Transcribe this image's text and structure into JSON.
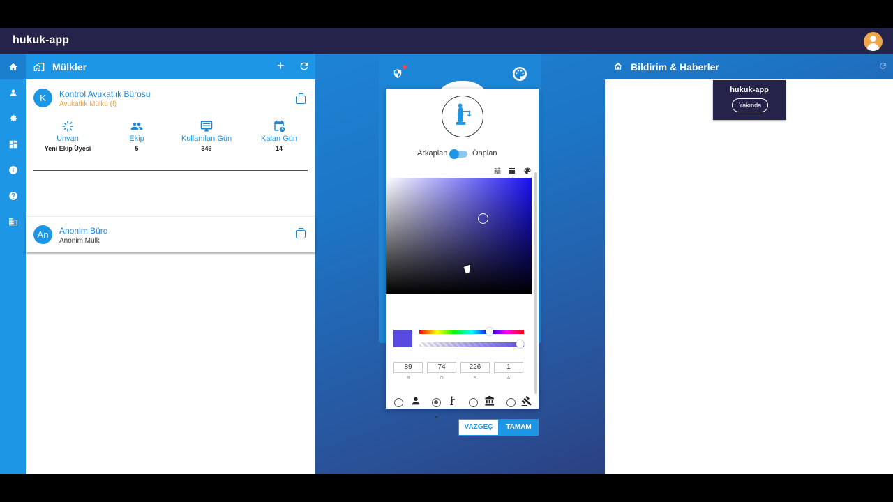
{
  "app": {
    "title": "hukuk-app"
  },
  "rail": {
    "icons": [
      "home-icon",
      "person-icon",
      "gear-icon",
      "dashboard-icon",
      "info-icon",
      "help-icon",
      "building-icon"
    ]
  },
  "left_panel": {
    "title": "Mülkler",
    "add_label": "+",
    "cards": [
      {
        "initial": "K",
        "name": "Kontrol Avukatlık Bürosu",
        "subtitle": "Avukatlık Mülkü (!)",
        "subtitle_color": "#f0a030",
        "stats": [
          {
            "label": "Unvan",
            "value": "Yeni Ekip Üyesi",
            "icon": "spinner-icon"
          },
          {
            "label": "Ekip",
            "value": "5",
            "icon": "people-icon"
          },
          {
            "label": "Kullanılan Gün",
            "value": "349",
            "icon": "monitor-icon"
          },
          {
            "label": "Kalan Gün",
            "value": "14",
            "icon": "calendar-icon"
          }
        ]
      },
      {
        "initial": "An",
        "name": "Anonim Büro",
        "subtitle": "Anonim Mülk"
      }
    ]
  },
  "color_dialog": {
    "toggle_left": "Arkaplan",
    "toggle_right": "Önplan",
    "selected_color": "#594ae2",
    "rgba": [
      {
        "label": "R",
        "value": "89"
      },
      {
        "label": "G",
        "value": "74"
      },
      {
        "label": "B",
        "value": "226"
      },
      {
        "label": "A",
        "value": "1"
      }
    ],
    "cancel_label": "VAZGEÇ",
    "ok_label": "TAMAM"
  },
  "right_panel": {
    "title": "Bildirim & Haberler",
    "news_title": "hukuk-app",
    "news_button": "Yakında"
  },
  "colors": {
    "primary": "#1e96e6",
    "topbar": "#26234a"
  }
}
